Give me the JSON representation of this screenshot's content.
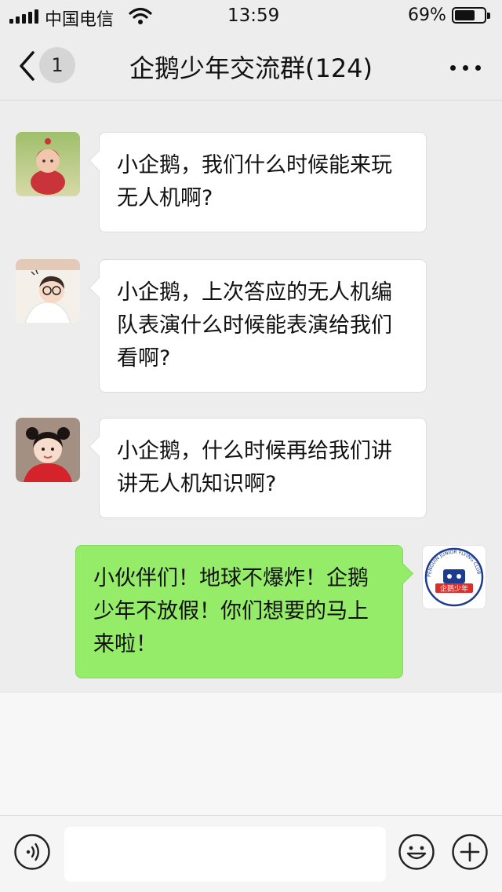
{
  "status_bar": {
    "carrier": "中国电信",
    "time": "13:59",
    "battery_percent_label": "69%",
    "battery_level": 0.69
  },
  "nav": {
    "unread_count": "1",
    "title": "企鹅少年交流群(124)"
  },
  "messages": [
    {
      "direction": "in",
      "avatar": "child-in-red-costume-avatar",
      "text": "小企鹅，我们什么时候能来玩无人机啊?"
    },
    {
      "direction": "in",
      "avatar": "child-with-glasses-avatar",
      "text": "小企鹅，上次答应的无人机编队表演什么时候能表演给我们看啊?"
    },
    {
      "direction": "in",
      "avatar": "girl-with-hair-buns-avatar",
      "text": "小企鹅，什么时候再给我们讲讲无人机知识啊?"
    },
    {
      "direction": "out",
      "avatar": "penguin-junior-flying-club-logo",
      "text": "小伙伴们！地球不爆炸！企鹅少年不放假！你们想要的马上来啦！"
    }
  ],
  "logo": {
    "ring_text": "PENGUIN JUNIOR FLYING CLUB",
    "banner_text": "企鹅少年"
  },
  "input": {
    "placeholder": ""
  },
  "icons": {
    "voice": "voice-icon",
    "emoji": "emoji-icon",
    "plus": "plus-icon"
  },
  "colors": {
    "outgoing_bubble": "#95ec69",
    "incoming_bubble": "#ffffff",
    "background": "#ededed",
    "logo_navy": "#1d3b8f",
    "logo_red": "#d9302c"
  }
}
